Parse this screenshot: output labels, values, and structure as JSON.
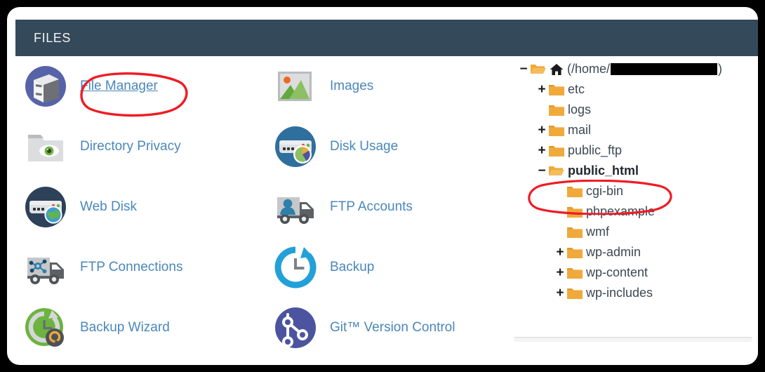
{
  "window": {
    "border_color": "#000000",
    "background": "#ffffff"
  },
  "header": {
    "title": "FILES",
    "background": "#34495a",
    "text_color": "#f2f4f6"
  },
  "theme": {
    "link_color": "#4a87bb",
    "tree_text_color": "#3d4852",
    "folder_color": "#f0a93b",
    "annotation_color": "#ee1c25"
  },
  "apps": {
    "column_left": [
      {
        "label": "File Manager",
        "icon": "file-manager-icon",
        "highlighted": true,
        "underlined": true
      },
      {
        "label": "Directory Privacy",
        "icon": "directory-privacy-icon",
        "highlighted": false,
        "underlined": false
      },
      {
        "label": "Web Disk",
        "icon": "web-disk-icon",
        "highlighted": false,
        "underlined": false
      },
      {
        "label": "FTP Connections",
        "icon": "ftp-connections-icon",
        "highlighted": false,
        "underlined": false
      },
      {
        "label": "Backup Wizard",
        "icon": "backup-wizard-icon",
        "highlighted": false,
        "underlined": false
      }
    ],
    "column_right": [
      {
        "label": "Images",
        "icon": "images-icon",
        "highlighted": false,
        "underlined": false
      },
      {
        "label": "Disk Usage",
        "icon": "disk-usage-icon",
        "highlighted": false,
        "underlined": false
      },
      {
        "label": "FTP Accounts",
        "icon": "ftp-accounts-icon",
        "highlighted": false,
        "underlined": false
      },
      {
        "label": "Backup",
        "icon": "backup-icon",
        "highlighted": false,
        "underlined": false
      },
      {
        "label": "Git™ Version Control",
        "icon": "git-version-control-icon",
        "highlighted": false,
        "underlined": false
      }
    ]
  },
  "file_tree": {
    "root": {
      "toggle": "−",
      "prefix_text": "(/home/",
      "redacted": true,
      "suffix_text": ")",
      "icon": "home-icon",
      "folder": "open"
    },
    "nodes": [
      {
        "toggle": "+",
        "label": "etc",
        "indent": 1,
        "folder": "closed",
        "bold": false,
        "circled": false
      },
      {
        "toggle": "",
        "label": "logs",
        "indent": 1,
        "folder": "closed",
        "bold": false,
        "circled": false
      },
      {
        "toggle": "+",
        "label": "mail",
        "indent": 1,
        "folder": "closed",
        "bold": false,
        "circled": false
      },
      {
        "toggle": "+",
        "label": "public_ftp",
        "indent": 1,
        "folder": "closed",
        "bold": false,
        "circled": false
      },
      {
        "toggle": "−",
        "label": "public_html",
        "indent": 1,
        "folder": "open",
        "bold": true,
        "circled": true
      },
      {
        "toggle": "",
        "label": "cgi-bin",
        "indent": 2,
        "folder": "closed",
        "bold": false,
        "circled": false
      },
      {
        "toggle": "",
        "label": "phpexample",
        "indent": 2,
        "folder": "closed",
        "bold": false,
        "circled": false
      },
      {
        "toggle": "",
        "label": "wmf",
        "indent": 2,
        "folder": "closed",
        "bold": false,
        "circled": false
      },
      {
        "toggle": "+",
        "label": "wp-admin",
        "indent": 2,
        "folder": "closed",
        "bold": false,
        "circled": false
      },
      {
        "toggle": "+",
        "label": "wp-content",
        "indent": 2,
        "folder": "closed",
        "bold": false,
        "circled": false
      },
      {
        "toggle": "+",
        "label": "wp-includes",
        "indent": 2,
        "folder": "closed",
        "bold": false,
        "circled": false
      }
    ]
  },
  "annotations": [
    {
      "target": "File Manager",
      "shape": "ellipse",
      "color": "#ee1c25"
    },
    {
      "target": "public_html",
      "shape": "ellipse",
      "color": "#ee1c25"
    }
  ]
}
